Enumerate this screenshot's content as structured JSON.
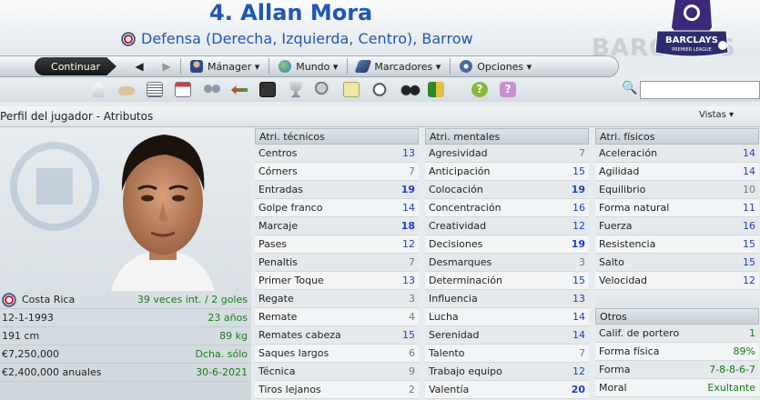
{
  "header": {
    "title": "4. Allan Mora",
    "subtitle": "Defensa (Derecha, Izquierda, Centro), Barrow",
    "watermark": "BARCLAYS",
    "logo_text": "BARCLAYS",
    "logo_subtext": "PREMIER LEAGUE"
  },
  "nav": {
    "continue_label": "Continuar",
    "menus": [
      {
        "label": "Mánager ▾",
        "icon": "manager-icon"
      },
      {
        "label": "Mundo ▾",
        "icon": "globe-icon"
      },
      {
        "label": "Marcadores ▾",
        "icon": "bookmark-icon"
      },
      {
        "label": "Opciones ▾",
        "icon": "gear-icon"
      }
    ]
  },
  "section": {
    "title": "Perfil del jugador - Atributos",
    "views_label": "Vistas ▾"
  },
  "player_info": [
    {
      "left": "Costa Rica",
      "right": "39 veces int. / 2 goles"
    },
    {
      "left": "12-1-1993",
      "right": "23 años"
    },
    {
      "left": "191 cm",
      "right": "89 kg"
    },
    {
      "left": "€7,250,000",
      "right": "Dcha. sólo"
    },
    {
      "left": "€2,400,000 anuales",
      "right": "30-6-2021"
    }
  ],
  "technical": {
    "header": "Atri. técnicos",
    "rows": [
      {
        "name": "Centros",
        "value": "13",
        "tier": "mid"
      },
      {
        "name": "Córners",
        "value": "7",
        "tier": "lo"
      },
      {
        "name": "Entradas",
        "value": "19",
        "tier": "hi"
      },
      {
        "name": "Golpe franco",
        "value": "14",
        "tier": "mid"
      },
      {
        "name": "Marcaje",
        "value": "18",
        "tier": "hi"
      },
      {
        "name": "Pases",
        "value": "12",
        "tier": "mid"
      },
      {
        "name": "Penaltis",
        "value": "7",
        "tier": "lo"
      },
      {
        "name": "Primer Toque",
        "value": "13",
        "tier": "mid"
      },
      {
        "name": "Regate",
        "value": "3",
        "tier": "lo"
      },
      {
        "name": "Remate",
        "value": "4",
        "tier": "lo"
      },
      {
        "name": "Remates cabeza",
        "value": "15",
        "tier": "mid"
      },
      {
        "name": "Saques largos",
        "value": "6",
        "tier": "lo"
      },
      {
        "name": "Técnica",
        "value": "9",
        "tier": "lo"
      },
      {
        "name": "Tiros lejanos",
        "value": "2",
        "tier": "lo"
      }
    ]
  },
  "mental": {
    "header": "Atri. mentales",
    "rows": [
      {
        "name": "Agresividad",
        "value": "7",
        "tier": "lo"
      },
      {
        "name": "Anticipación",
        "value": "15",
        "tier": "mid"
      },
      {
        "name": "Colocación",
        "value": "19",
        "tier": "hi"
      },
      {
        "name": "Concentración",
        "value": "16",
        "tier": "mid"
      },
      {
        "name": "Creatividad",
        "value": "12",
        "tier": "mid"
      },
      {
        "name": "Decisiones",
        "value": "19",
        "tier": "hi"
      },
      {
        "name": "Desmarques",
        "value": "3",
        "tier": "lo"
      },
      {
        "name": "Determinación",
        "value": "15",
        "tier": "mid"
      },
      {
        "name": "Influencia",
        "value": "13",
        "tier": "mid"
      },
      {
        "name": "Lucha",
        "value": "14",
        "tier": "mid"
      },
      {
        "name": "Serenidad",
        "value": "14",
        "tier": "mid"
      },
      {
        "name": "Talento",
        "value": "7",
        "tier": "lo"
      },
      {
        "name": "Trabajo equipo",
        "value": "12",
        "tier": "mid"
      },
      {
        "name": "Valentía",
        "value": "20",
        "tier": "hi"
      }
    ]
  },
  "physical": {
    "header": "Atri. físicos",
    "rows": [
      {
        "name": "Aceleración",
        "value": "14",
        "tier": "mid"
      },
      {
        "name": "Agilidad",
        "value": "14",
        "tier": "mid"
      },
      {
        "name": "Equilibrio",
        "value": "10",
        "tier": "lo"
      },
      {
        "name": "Forma natural",
        "value": "11",
        "tier": "mid"
      },
      {
        "name": "Fuerza",
        "value": "16",
        "tier": "mid"
      },
      {
        "name": "Resistencia",
        "value": "15",
        "tier": "mid"
      },
      {
        "name": "Salto",
        "value": "15",
        "tier": "mid"
      },
      {
        "name": "Velocidad",
        "value": "12",
        "tier": "mid"
      }
    ]
  },
  "others": {
    "header": "Otros",
    "rows": [
      {
        "name": "Calif. de portero",
        "value": "1"
      },
      {
        "name": "Forma física",
        "value": "89%"
      },
      {
        "name": "Forma",
        "value": "7-8-8-6-7"
      },
      {
        "name": "Moral",
        "value": "Exultante"
      }
    ]
  },
  "colors": {
    "accent": "#1f57b4",
    "value_blue": "#1f3fc4",
    "value_green": "#1a7a1a"
  }
}
